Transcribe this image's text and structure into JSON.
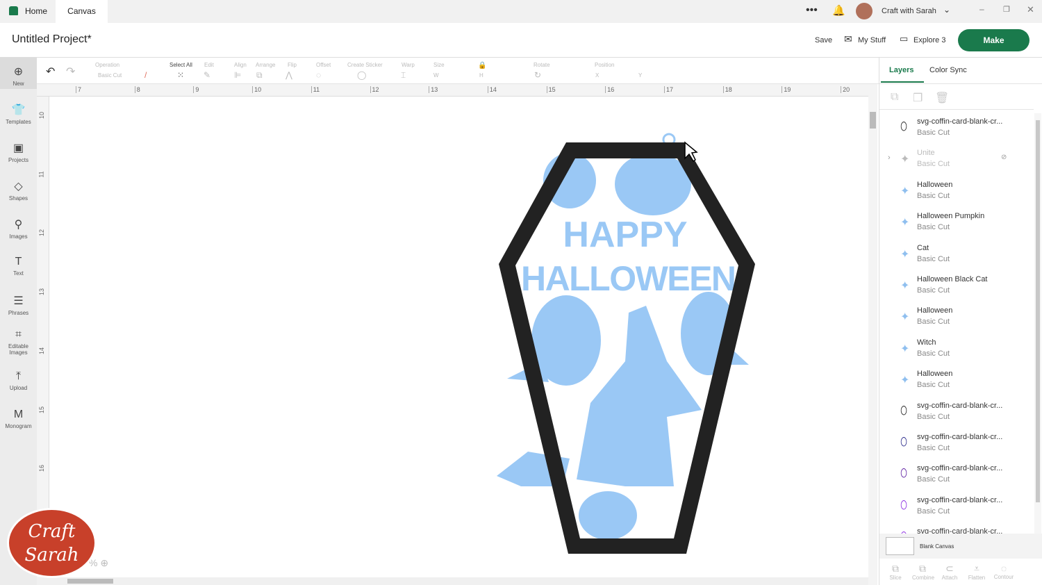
{
  "tabs": [
    {
      "label": "Home"
    },
    {
      "label": "Canvas"
    }
  ],
  "top_right": {
    "user": "Craft with Sarah"
  },
  "header": {
    "title": "Untitled Project*",
    "save": "Save",
    "my_stuff": "My Stuff",
    "machine": "Explore 3",
    "make": "Make"
  },
  "toolbar": {
    "operation_label": "Operation",
    "operation_value": "Basic Cut",
    "select_all": "Select All",
    "edit": "Edit",
    "align": "Align",
    "arrange": "Arrange",
    "flip": "Flip",
    "offset": "Offset",
    "create_sticker": "Create Sticker",
    "warp": "Warp",
    "size": "Size",
    "w": "W",
    "h": "H",
    "rotate": "Rotate",
    "position": "Position",
    "x": "X",
    "y": "Y"
  },
  "sidebar": [
    {
      "label": "New",
      "icon": "⊕"
    },
    {
      "label": "Templates",
      "icon": "👕"
    },
    {
      "label": "Projects",
      "icon": "▣"
    },
    {
      "label": "Shapes",
      "icon": "◇"
    },
    {
      "label": "Images",
      "icon": "⚲"
    },
    {
      "label": "Text",
      "icon": "T"
    },
    {
      "label": "Phrases",
      "icon": "☰"
    },
    {
      "label": "Editable Images",
      "icon": "⌗"
    },
    {
      "label": "Upload",
      "icon": "⤒"
    },
    {
      "label": "Monogram",
      "icon": "M"
    }
  ],
  "ruler_h": [
    "7",
    "8",
    "9",
    "10",
    "11",
    "12",
    "13",
    "14",
    "15",
    "16",
    "17",
    "18",
    "19",
    "20"
  ],
  "ruler_v": [
    "10",
    "11",
    "12",
    "13",
    "14",
    "15",
    "16"
  ],
  "panel": {
    "tab_layers": "Layers",
    "tab_color_sync": "Color Sync",
    "blank_canvas": "Blank Canvas",
    "layers": [
      {
        "name": "svg-coffin-card-blank-cr...",
        "op": "Basic Cut",
        "color": "#222222"
      },
      {
        "name": "Unite",
        "op": "Basic Cut",
        "color": "#bbbbbb",
        "hidden": true
      },
      {
        "name": "Halloween",
        "op": "Basic Cut",
        "color": "#8fbfef"
      },
      {
        "name": "Halloween Pumpkin",
        "op": "Basic Cut",
        "color": "#8fbfef"
      },
      {
        "name": "Cat",
        "op": "Basic Cut",
        "color": "#8fbfef"
      },
      {
        "name": "Halloween Black Cat",
        "op": "Basic Cut",
        "color": "#8fbfef"
      },
      {
        "name": "Halloween",
        "op": "Basic Cut",
        "color": "#8fbfef"
      },
      {
        "name": "Witch",
        "op": "Basic Cut",
        "color": "#8fbfef"
      },
      {
        "name": "Halloween",
        "op": "Basic Cut",
        "color": "#8fbfef"
      },
      {
        "name": "svg-coffin-card-blank-cr...",
        "op": "Basic Cut",
        "color": "#222222"
      },
      {
        "name": "svg-coffin-card-blank-cr...",
        "op": "Basic Cut",
        "color": "#2a2a8a"
      },
      {
        "name": "svg-coffin-card-blank-cr...",
        "op": "Basic Cut",
        "color": "#5a1aa0"
      },
      {
        "name": "svg-coffin-card-blank-cr...",
        "op": "Basic Cut",
        "color": "#8a2be2"
      },
      {
        "name": "svg-coffin-card-blank-cr...",
        "op": "",
        "color": "#8a2be2"
      }
    ],
    "bottom": [
      "Slice",
      "Combine",
      "Attach",
      "Flatten",
      "Contour"
    ]
  },
  "canvas": {
    "text_line1": "HAPPY",
    "text_line2": "HALLOWEEN",
    "zoom_suffix": "%"
  },
  "logo": {
    "text": "Craft with Sarah"
  },
  "colors": {
    "accent": "#1a7a4c",
    "shape_blue": "#9ac8f5",
    "coffin": "#222222"
  }
}
